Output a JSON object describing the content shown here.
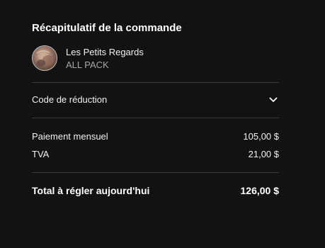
{
  "summary": {
    "title": "Récapitulatif de la commande"
  },
  "product": {
    "name": "Les Petits Regards",
    "variant": "ALL PACK",
    "thumbnail_icon": "product-thumbnail"
  },
  "discount": {
    "label": "Code de réduction",
    "icon": "chevron-down-icon"
  },
  "lines": [
    {
      "label": "Paiement mensuel",
      "value": "105,00 $"
    },
    {
      "label": "TVA",
      "value": "21,00 $"
    }
  ],
  "total": {
    "label": "Total à régler aujourd'hui",
    "value": "126,00 $"
  },
  "colors": {
    "background": "#121212",
    "text": "#ffffff",
    "muted": "#a7a7a7",
    "divider": "#3a3a3a"
  }
}
